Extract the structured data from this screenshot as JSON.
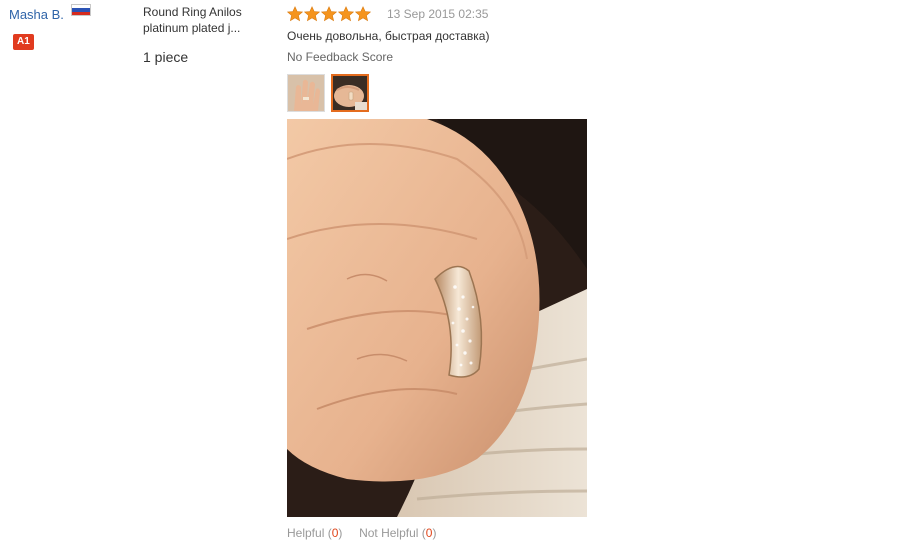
{
  "user": {
    "name": "Masha B.",
    "country_flag": "russia-flag-icon",
    "level_badge": "A1",
    "badge_color": "#e13b1f"
  },
  "product": {
    "title_line1": "Round Ring Anilos",
    "title_line2": "platinum plated j...",
    "quantity": "1 piece"
  },
  "review": {
    "rating": 5,
    "rating_max": 5,
    "star_color": "#f5941d",
    "date": "13 Sep 2015 02:35",
    "text": "Очень довольна, быстрая доставка)",
    "feedback_score": "No Feedback Score",
    "thumbnails": [
      {
        "name": "photo-thumbnail-1",
        "selected": false
      },
      {
        "name": "photo-thumbnail-2",
        "selected": true
      }
    ],
    "main_photo": "ring-on-hand-photo"
  },
  "helpful": {
    "helpful_label": "Helpful",
    "helpful_count": "0",
    "not_helpful_label": "Not Helpful",
    "not_helpful_count": "0",
    "count_color": "#e0461b"
  }
}
